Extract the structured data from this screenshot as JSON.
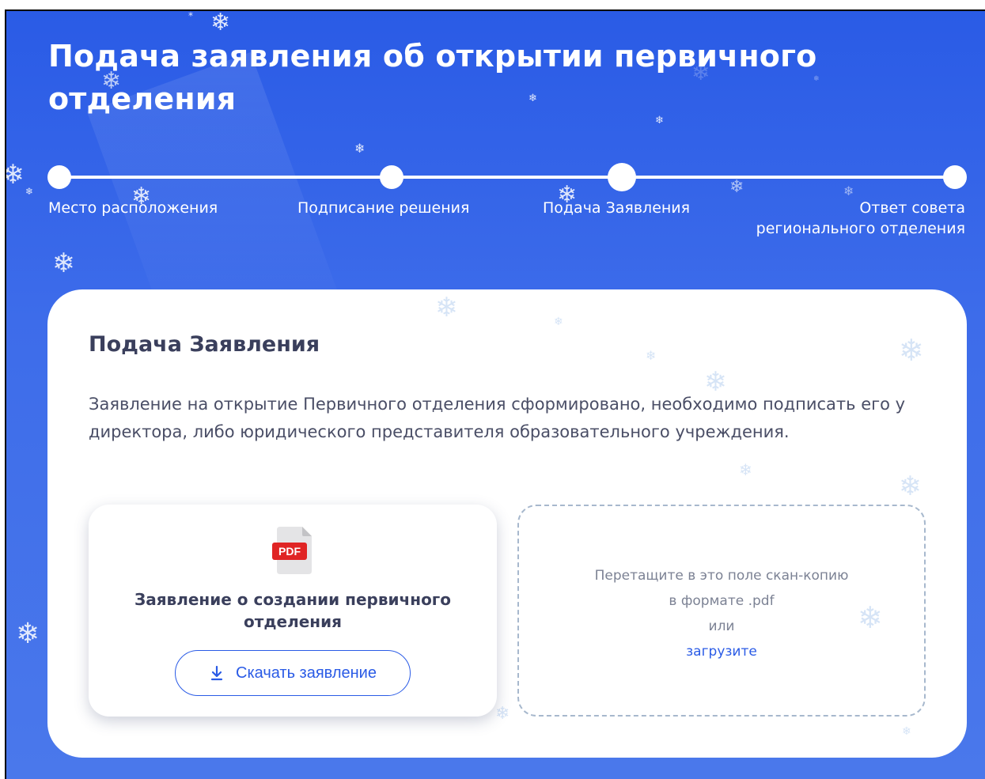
{
  "page": {
    "title": "Подача заявления об открытии первичного отделения"
  },
  "stepper": {
    "steps": [
      {
        "label": "Место расположения"
      },
      {
        "label": "Подписание решения"
      },
      {
        "label": "Подача Заявления"
      },
      {
        "label_line1": "Ответ совета",
        "label_line2": "регионального отделения"
      }
    ],
    "active_step": 3
  },
  "card": {
    "title": "Подача Заявления",
    "text": "Заявление на открытие Первичного отделения сформировано, необходимо подписать его у директора, либо юридического представителя образовательного учреждения.",
    "document": {
      "icon": "pdf-file-icon",
      "icon_label": "PDF",
      "title": "Заявление о создании первичного отделения",
      "download_label": "Скачать заявление",
      "download_icon": "download-icon"
    },
    "drop_zone": {
      "line1": "Перетащите в это поле скан-копию",
      "line2": "в формате .pdf",
      "line3": "или",
      "upload_link": "загрузите"
    }
  },
  "colors": {
    "background": "#2a5be6",
    "accent": "#2a5be6",
    "pdf_red": "#e02424",
    "heading_text": "#3a3f5c"
  }
}
